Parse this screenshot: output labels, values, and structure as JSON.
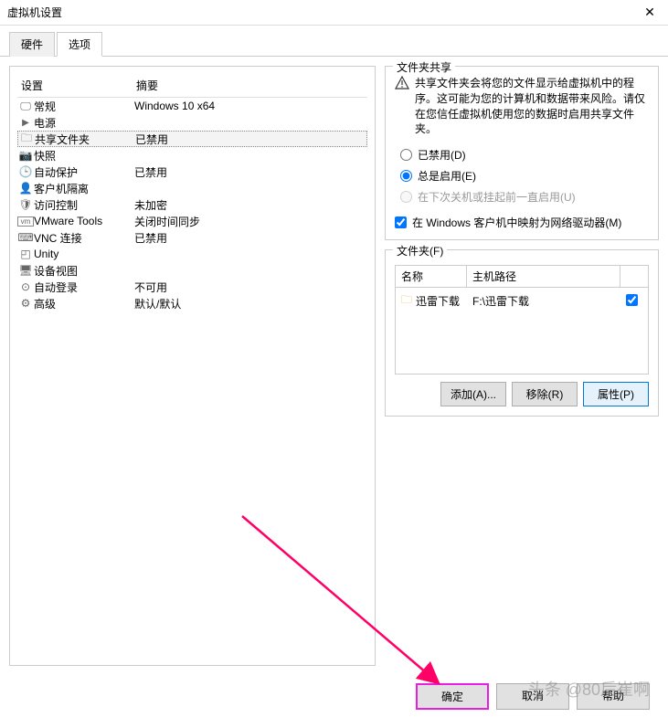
{
  "window": {
    "title": "虚拟机设置"
  },
  "tabs": {
    "hardware": "硬件",
    "options": "选项"
  },
  "list": {
    "header_device": "设置",
    "header_summary": "摘要",
    "items": [
      {
        "icon": "monitor",
        "label": "常规",
        "summary": "Windows 10 x64"
      },
      {
        "icon": "play",
        "label": "电源",
        "summary": ""
      },
      {
        "icon": "folder",
        "label": "共享文件夹",
        "summary": "已禁用",
        "selected": true
      },
      {
        "icon": "camera",
        "label": "快照",
        "summary": ""
      },
      {
        "icon": "clock",
        "label": "自动保护",
        "summary": "已禁用"
      },
      {
        "icon": "guest",
        "label": "客户机隔离",
        "summary": ""
      },
      {
        "icon": "shield",
        "label": "访问控制",
        "summary": "未加密"
      },
      {
        "icon": "vm",
        "label": "VMware Tools",
        "summary": "关闭时间同步"
      },
      {
        "icon": "vnc",
        "label": "VNC 连接",
        "summary": "已禁用"
      },
      {
        "icon": "unity",
        "label": "Unity",
        "summary": ""
      },
      {
        "icon": "display",
        "label": "设备视图",
        "summary": ""
      },
      {
        "icon": "login",
        "label": "自动登录",
        "summary": "不可用"
      },
      {
        "icon": "advanced",
        "label": "高级",
        "summary": "默认/默认"
      }
    ]
  },
  "share": {
    "legend": "文件夹共享",
    "warning": "共享文件夹会将您的文件显示给虚拟机中的程序。这可能为您的计算机和数据带来风险。请仅在您信任虚拟机使用您的数据时启用共享文件夹。",
    "radio_disabled": "已禁用(D)",
    "radio_always": "总是启用(E)",
    "radio_next": "在下次关机或挂起前一直启用(U)",
    "checkbox_map": "在 Windows 客户机中映射为网络驱动器(M)"
  },
  "folders": {
    "legend": "文件夹(F)",
    "header_name": "名称",
    "header_path": "主机路径",
    "rows": [
      {
        "name": "迅雷下载",
        "path": "F:\\迅雷下载",
        "checked": true
      }
    ],
    "btn_add": "添加(A)...",
    "btn_remove": "移除(R)",
    "btn_props": "属性(P)"
  },
  "footer": {
    "ok": "确定",
    "cancel": "取消",
    "help": "帮助"
  },
  "watermark": "头条 @80后崔啊"
}
